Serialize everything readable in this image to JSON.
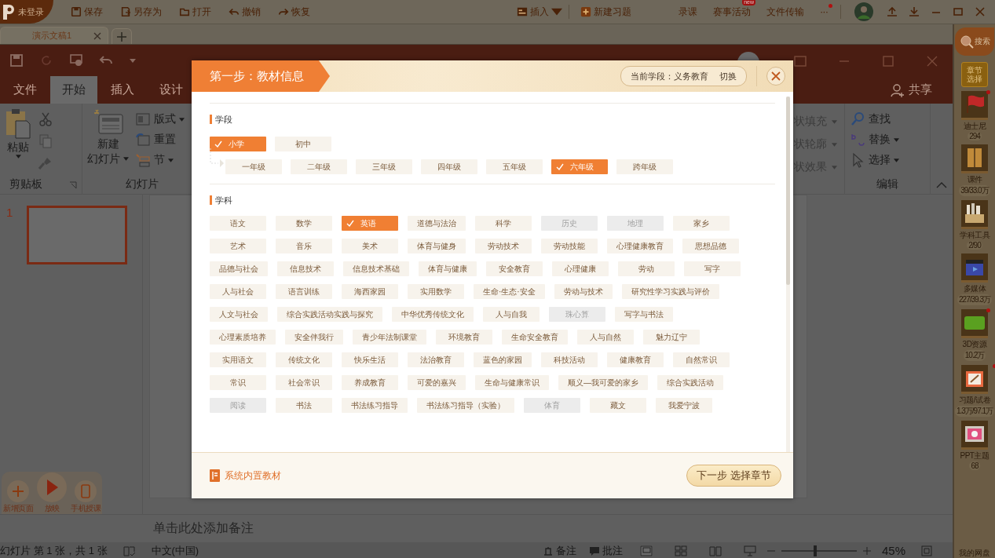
{
  "topbar": {
    "login": "未登录",
    "actions": [
      {
        "kind": "save",
        "label": "保存"
      },
      {
        "kind": "saveas",
        "label": "另存为"
      },
      {
        "kind": "open",
        "label": "打开"
      },
      {
        "kind": "undo",
        "label": "撤销"
      },
      {
        "kind": "redo",
        "label": "恢复"
      }
    ],
    "insert": "插入",
    "new_exercise": "新建习题",
    "links": [
      {
        "label": "录课"
      },
      {
        "label": "赛事活动",
        "badge": "new"
      },
      {
        "label": "文件传输"
      }
    ],
    "more": "···"
  },
  "doc_tabs": [
    {
      "label": "演示文稿1",
      "selected": true
    }
  ],
  "ppt": {
    "tabs": [
      {
        "label": "文件",
        "selected": false
      },
      {
        "label": "开始",
        "selected": true
      },
      {
        "label": "插入",
        "selected": false
      },
      {
        "label": "设计",
        "selected": false
      }
    ],
    "share": "共享",
    "clipboard": {
      "paste": "粘贴",
      "label": "剪贴板"
    },
    "slides": {
      "new_lines": [
        "新建",
        "幻灯片"
      ],
      "buttons": [
        {
          "kind": "layout",
          "label": "版式"
        },
        {
          "kind": "reset",
          "label": "重置"
        },
        {
          "kind": "section",
          "label": "节"
        }
      ],
      "label": "幻灯片"
    },
    "shape": [
      "状填充",
      "状轮廓",
      "状效果"
    ],
    "editing": {
      "buttons": [
        {
          "kind": "find",
          "label": "查找"
        },
        {
          "kind": "replace",
          "label": "替换"
        },
        {
          "kind": "select",
          "label": "选择"
        }
      ],
      "label": "编辑"
    },
    "thumbnails": [
      {
        "number": "1",
        "selected": true
      }
    ],
    "notes": "单击此处添加备注",
    "float_buttons": [
      {
        "kind": "add",
        "label": "新增页面"
      },
      {
        "kind": "play",
        "label": "放映"
      },
      {
        "kind": "phone",
        "label": "手机授课"
      }
    ],
    "status": {
      "slide_info": "幻灯片 第 1 张，共 1 张",
      "language": "中文(中国)",
      "notes": "备注",
      "comments": "批注",
      "zoom": "45%",
      "zoom_slider": {
        "level": 0.45
      }
    }
  },
  "sidebar": {
    "search": "搜索",
    "chapter": "章节选择",
    "items": [
      {
        "kind": "flag",
        "label": "迪士尼",
        "count": "294",
        "dot": true
      },
      {
        "kind": "book",
        "label": "课件",
        "count": "39/33.0万",
        "dot": false
      },
      {
        "kind": "box",
        "label": "学科工具",
        "count": "2/90",
        "dot": false
      },
      {
        "kind": "clapper",
        "label": "多媒体",
        "count": "227/39.3万",
        "dot": false
      },
      {
        "kind": "threed",
        "label": "3D资源",
        "count": "10.2万",
        "dot": true
      },
      {
        "kind": "easel",
        "label": "习题/试卷",
        "count": "1.3万/97.1万",
        "dot": true
      },
      {
        "kind": "theme",
        "label": "PPT主题",
        "count": "68",
        "dot": false
      }
    ],
    "disk": "我的网盘"
  },
  "dialog": {
    "title": "第一步：教材信息",
    "current_stage": "当前学段：义务教育",
    "switch": "切换",
    "stage_label": "学段",
    "stages": [
      {
        "label": "小学",
        "selected": true
      },
      {
        "label": "初中",
        "selected": false
      }
    ],
    "grades": [
      {
        "label": "一年级",
        "selected": false
      },
      {
        "label": "二年级",
        "selected": false
      },
      {
        "label": "三年级",
        "selected": false
      },
      {
        "label": "四年级",
        "selected": false
      },
      {
        "label": "五年级",
        "selected": false
      },
      {
        "label": "六年级",
        "selected": true
      },
      {
        "label": "跨年级",
        "selected": false
      }
    ],
    "subject_label": "学科",
    "subject_rows": [
      {
        "items": [
          {
            "label": "语文",
            "selected": false,
            "disabled": false
          },
          {
            "label": "数学",
            "selected": false,
            "disabled": false
          },
          {
            "label": "英语",
            "selected": true,
            "disabled": false
          },
          {
            "label": "道德与法治",
            "selected": false,
            "disabled": false
          },
          {
            "label": "科学",
            "selected": false,
            "disabled": false
          },
          {
            "label": "历史",
            "selected": false,
            "disabled": true
          },
          {
            "label": "地理",
            "selected": false,
            "disabled": true
          },
          {
            "label": "家乡",
            "selected": false,
            "disabled": false
          }
        ]
      },
      {
        "items": [
          {
            "label": "艺术",
            "selected": false,
            "disabled": false
          },
          {
            "label": "音乐",
            "selected": false,
            "disabled": false
          },
          {
            "label": "美术",
            "selected": false,
            "disabled": false
          },
          {
            "label": "体育与健身",
            "selected": false,
            "disabled": false
          },
          {
            "label": "劳动技术",
            "selected": false,
            "disabled": false
          },
          {
            "label": "劳动技能",
            "selected": false,
            "disabled": false
          },
          {
            "label": "心理健康教育",
            "selected": false,
            "disabled": false
          },
          {
            "label": "思想品德",
            "selected": false,
            "disabled": false
          }
        ]
      },
      {
        "items": [
          {
            "label": "品德与社会",
            "selected": false,
            "disabled": false
          },
          {
            "label": "信息技术",
            "selected": false,
            "disabled": false
          },
          {
            "label": "信息技术基础",
            "selected": false,
            "disabled": false
          },
          {
            "label": "体育与健康",
            "selected": false,
            "disabled": false
          },
          {
            "label": "安全教育",
            "selected": false,
            "disabled": false
          },
          {
            "label": "心理健康",
            "selected": false,
            "disabled": false
          },
          {
            "label": "劳动",
            "selected": false,
            "disabled": false
          },
          {
            "label": "写字",
            "selected": false,
            "disabled": false
          }
        ]
      },
      {
        "items": [
          {
            "label": "人与社会",
            "selected": false,
            "disabled": false
          },
          {
            "label": "语言训练",
            "selected": false,
            "disabled": false
          },
          {
            "label": "海西家园",
            "selected": false,
            "disabled": false
          },
          {
            "label": "实用数学",
            "selected": false,
            "disabled": false
          },
          {
            "label": "生命·生态·安全",
            "selected": false,
            "disabled": false
          },
          {
            "label": "劳动与技术",
            "selected": false,
            "disabled": false
          },
          {
            "label": "研究性学习实践与评价",
            "selected": false,
            "disabled": false
          }
        ]
      },
      {
        "items": [
          {
            "label": "人文与社会",
            "selected": false,
            "disabled": false
          },
          {
            "label": "综合实践活动实践与探究",
            "selected": false,
            "disabled": false
          },
          {
            "label": "中华优秀传统文化",
            "selected": false,
            "disabled": false
          },
          {
            "label": "人与自我",
            "selected": false,
            "disabled": false
          },
          {
            "label": "珠心算",
            "selected": false,
            "disabled": true
          },
          {
            "label": "写字与书法",
            "selected": false,
            "disabled": false
          }
        ]
      },
      {
        "items": [
          {
            "label": "心理素质培养",
            "selected": false,
            "disabled": false
          },
          {
            "label": "安全伴我行",
            "selected": false,
            "disabled": false
          },
          {
            "label": "青少年法制课堂",
            "selected": false,
            "disabled": false
          },
          {
            "label": "环境教育",
            "selected": false,
            "disabled": false
          },
          {
            "label": "生命安全教育",
            "selected": false,
            "disabled": false
          },
          {
            "label": "人与自然",
            "selected": false,
            "disabled": false
          },
          {
            "label": "魅力辽宁",
            "selected": false,
            "disabled": false
          }
        ]
      },
      {
        "items": [
          {
            "label": "实用语文",
            "selected": false,
            "disabled": false
          },
          {
            "label": "传统文化",
            "selected": false,
            "disabled": false
          },
          {
            "label": "快乐生活",
            "selected": false,
            "disabled": false
          },
          {
            "label": "法治教育",
            "selected": false,
            "disabled": false
          },
          {
            "label": "蓝色的家园",
            "selected": false,
            "disabled": false
          },
          {
            "label": "科技活动",
            "selected": false,
            "disabled": false
          },
          {
            "label": "健康教育",
            "selected": false,
            "disabled": false
          },
          {
            "label": "自然常识",
            "selected": false,
            "disabled": false
          }
        ]
      },
      {
        "items": [
          {
            "label": "常识",
            "selected": false,
            "disabled": false
          },
          {
            "label": "社会常识",
            "selected": false,
            "disabled": false
          },
          {
            "label": "养成教育",
            "selected": false,
            "disabled": false
          },
          {
            "label": "可爱的嘉兴",
            "selected": false,
            "disabled": false
          },
          {
            "label": "生命与健康常识",
            "selected": false,
            "disabled": false
          },
          {
            "label": "顺义—我可爱的家乡",
            "selected": false,
            "disabled": false
          },
          {
            "label": "综合实践活动",
            "selected": false,
            "disabled": false
          }
        ]
      },
      {
        "items": [
          {
            "label": "阅读",
            "selected": false,
            "disabled": true
          },
          {
            "label": "书法",
            "selected": false,
            "disabled": false
          },
          {
            "label": "书法练习指导",
            "selected": false,
            "disabled": false
          },
          {
            "label": "书法练习指导（实验）",
            "selected": false,
            "disabled": false
          },
          {
            "label": "体育",
            "selected": false,
            "disabled": true
          },
          {
            "label": "藏文",
            "selected": false,
            "disabled": false
          },
          {
            "label": "我爱宁波",
            "selected": false,
            "disabled": false
          }
        ]
      }
    ],
    "footer_link": "系统内置教材",
    "next": "下一步 选择章节"
  }
}
